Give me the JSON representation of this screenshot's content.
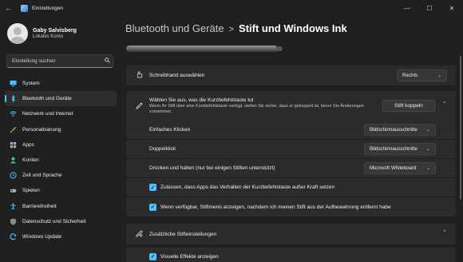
{
  "window": {
    "title": "Einstellungen",
    "controls": {
      "minimize": "—",
      "maximize": "☐",
      "close": "✕"
    },
    "back_glyph": "←"
  },
  "profile": {
    "name": "Gaby Salvisberg",
    "account_type": "Lokales Konto"
  },
  "search": {
    "placeholder": "Einstellung suchen",
    "icon": "search-icon"
  },
  "nav": {
    "items": [
      {
        "label": "System",
        "icon": "monitor-icon",
        "color": "#4cc2ff"
      },
      {
        "label": "Bluetooth und Geräte",
        "icon": "bluetooth-icon",
        "color": "#4cc2ff",
        "active": true
      },
      {
        "label": "Netzwerk und Internet",
        "icon": "wifi-icon",
        "color": "#4cc2ff"
      },
      {
        "label": "Personalisierung",
        "icon": "brush-icon",
        "color": "#f2a25c"
      },
      {
        "label": "Apps",
        "icon": "apps-icon",
        "color": "#b0b0b0"
      },
      {
        "label": "Konten",
        "icon": "person-icon",
        "color": "#3fd08f"
      },
      {
        "label": "Zeit und Sprache",
        "icon": "clock-globe-icon",
        "color": "#4cc2ff"
      },
      {
        "label": "Spielen",
        "icon": "gamepad-icon",
        "color": "#b0b0b0"
      },
      {
        "label": "Barrierefreiheit",
        "icon": "accessibility-icon",
        "color": "#4cc2ff"
      },
      {
        "label": "Datenschutz und Sicherheit",
        "icon": "shield-icon",
        "color": "#8a8a8a"
      },
      {
        "label": "Windows Update",
        "icon": "update-icon",
        "color": "#4cc2ff"
      }
    ]
  },
  "breadcrumb": {
    "parent": "Bluetooth und Geräte",
    "separator": ">",
    "current": "Stift und Windows Ink"
  },
  "settings": {
    "handedness": {
      "label": "Schreibhand auswählen",
      "value": "Rechts",
      "icon": "hand-icon"
    },
    "shortcut": {
      "label": "Wählen Sie aus, was die Kurzbefehlstaste tut",
      "description": "Wenn Ihr Stift über eine Kurzbefehlstaste verfügt, stellen Sie sicher, dass er gekoppelt ist, bevor Sie Änderungen vornehmen.",
      "button": "Stift koppeln",
      "icon": "pen-icon"
    },
    "single_click": {
      "label": "Einfaches Klicken",
      "value": "Bildschirmausschnitte"
    },
    "double_click": {
      "label": "Doppelklick",
      "value": "Bildschirmausschnitte"
    },
    "press_hold": {
      "label": "Drücken und halten (nur bei einigen Stiften unterstützt)",
      "value": "Microsoft Whiteboard"
    },
    "allow_apps": {
      "label": "Zulassen, dass Apps das Verhalten der Kurzbefehlstaste außer Kraft setzen",
      "checked": true
    },
    "pen_menu": {
      "label": "Wenn verfügbar, Stiftmenü anzeigen, nachdem ich meinen Stift aus der Aufbewahrung entfernt habe",
      "checked": true
    },
    "additional": {
      "label": "Zusätzliche Stifteinstellungen",
      "icon": "pen-settings-icon"
    },
    "visual_effects": {
      "label": "Visuelle Effekte anzeigen",
      "checked": true
    }
  },
  "glyphs": {
    "chevron_down": "⌄",
    "chevron_up": "⌃",
    "check": "✓"
  }
}
